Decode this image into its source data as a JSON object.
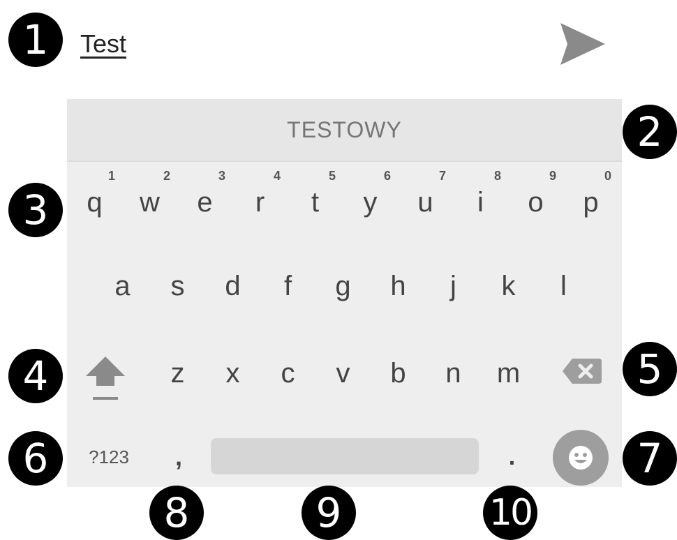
{
  "input": {
    "text": "Test"
  },
  "suggestion": {
    "text": "TESTOWY"
  },
  "keyboard": {
    "row1": [
      {
        "char": "q",
        "hint": "1"
      },
      {
        "char": "w",
        "hint": "2"
      },
      {
        "char": "e",
        "hint": "3"
      },
      {
        "char": "r",
        "hint": "4"
      },
      {
        "char": "t",
        "hint": "5"
      },
      {
        "char": "y",
        "hint": "6"
      },
      {
        "char": "u",
        "hint": "7"
      },
      {
        "char": "i",
        "hint": "8"
      },
      {
        "char": "o",
        "hint": "9"
      },
      {
        "char": "p",
        "hint": "0"
      }
    ],
    "row2": [
      "a",
      "s",
      "d",
      "f",
      "g",
      "h",
      "j",
      "k",
      "l"
    ],
    "row3": [
      "z",
      "x",
      "c",
      "v",
      "b",
      "n",
      "m"
    ],
    "symbols_label": "?123",
    "comma_label": ",",
    "period_label": "."
  },
  "callouts": [
    "1",
    "2",
    "3",
    "4",
    "5",
    "6",
    "7",
    "8",
    "9",
    "10"
  ],
  "icons": {
    "send": "send-icon",
    "shift": "shift-icon",
    "backspace": "backspace-icon",
    "emoji": "emoji-icon"
  },
  "colors": {
    "keyboard_bg": "#eeeeee",
    "suggestion_bg": "#e6e6e6",
    "key_text": "#444444",
    "icon_gray": "#9e9e9e",
    "badge": "#000000"
  }
}
